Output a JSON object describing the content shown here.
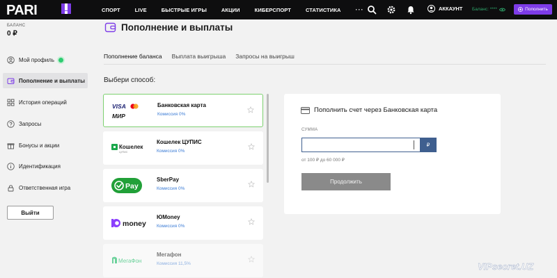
{
  "header": {
    "logo_text": "PARI",
    "nav": [
      "СПОРТ",
      "LIVE",
      "БЫСТРЫЕ ИГРЫ",
      "АКЦИИ",
      "КИБЕРСПОРТ",
      "СТАТИСТИКА"
    ],
    "more": "···",
    "account": "АККАУНТ",
    "balance": "Баланс: ****",
    "topup": "Пополнить"
  },
  "sidebar": {
    "balance_label": "БАЛАНС",
    "balance_value": "0 ₽",
    "items": [
      {
        "label": "Мой профиль",
        "icon": "user-icon"
      },
      {
        "label": "Пополнение и выплаты",
        "icon": "wallet-icon"
      },
      {
        "label": "История операций",
        "icon": "grid-icon"
      },
      {
        "label": "Запросы",
        "icon": "question-icon"
      },
      {
        "label": "Бонусы и акции",
        "icon": "gift-icon"
      },
      {
        "label": "Идентификация",
        "icon": "info-icon"
      },
      {
        "label": "Ответственная игра",
        "icon": "lock-icon"
      }
    ],
    "logout": "Выйти"
  },
  "main": {
    "title": "Пополнение и выплаты",
    "tabs": [
      "Пополнение баланса",
      "Выплата выигрыша",
      "Запросы на выигрыш"
    ],
    "choose": "Выбери способ:",
    "methods": [
      {
        "name": "Банковская карта",
        "fee": "Комиссия 0%"
      },
      {
        "name": "Кошелек ЦУПИС",
        "fee": "Комиссия 0%"
      },
      {
        "name": "SberPay",
        "fee": "Комиссия 0%"
      },
      {
        "name": "ЮMoney",
        "fee": "Комиссия 0%"
      },
      {
        "name": "Мегафон",
        "fee": "Комиссия 11,5%"
      }
    ],
    "panel": {
      "title": "Пополнить счет через Банковская карта",
      "sum_label": "СУММА",
      "currency": "₽",
      "range": "от 100 ₽ до 60 000 ₽",
      "continue": "Продолжить"
    }
  },
  "logos": {
    "visa": "VISA",
    "mir": "МИР",
    "koshelek": "Кошелек",
    "koshelek_sub": "ЦУПИС",
    "pay": "Pay",
    "money": "money",
    "megafon": "МегаФон"
  },
  "watermark": "VIPsecret.UZ",
  "colors": {
    "accent": "#7d3ce8",
    "selected_border": "#7cd06f",
    "fee": "#3a7bd5",
    "input_border": "#3f5f8f"
  }
}
